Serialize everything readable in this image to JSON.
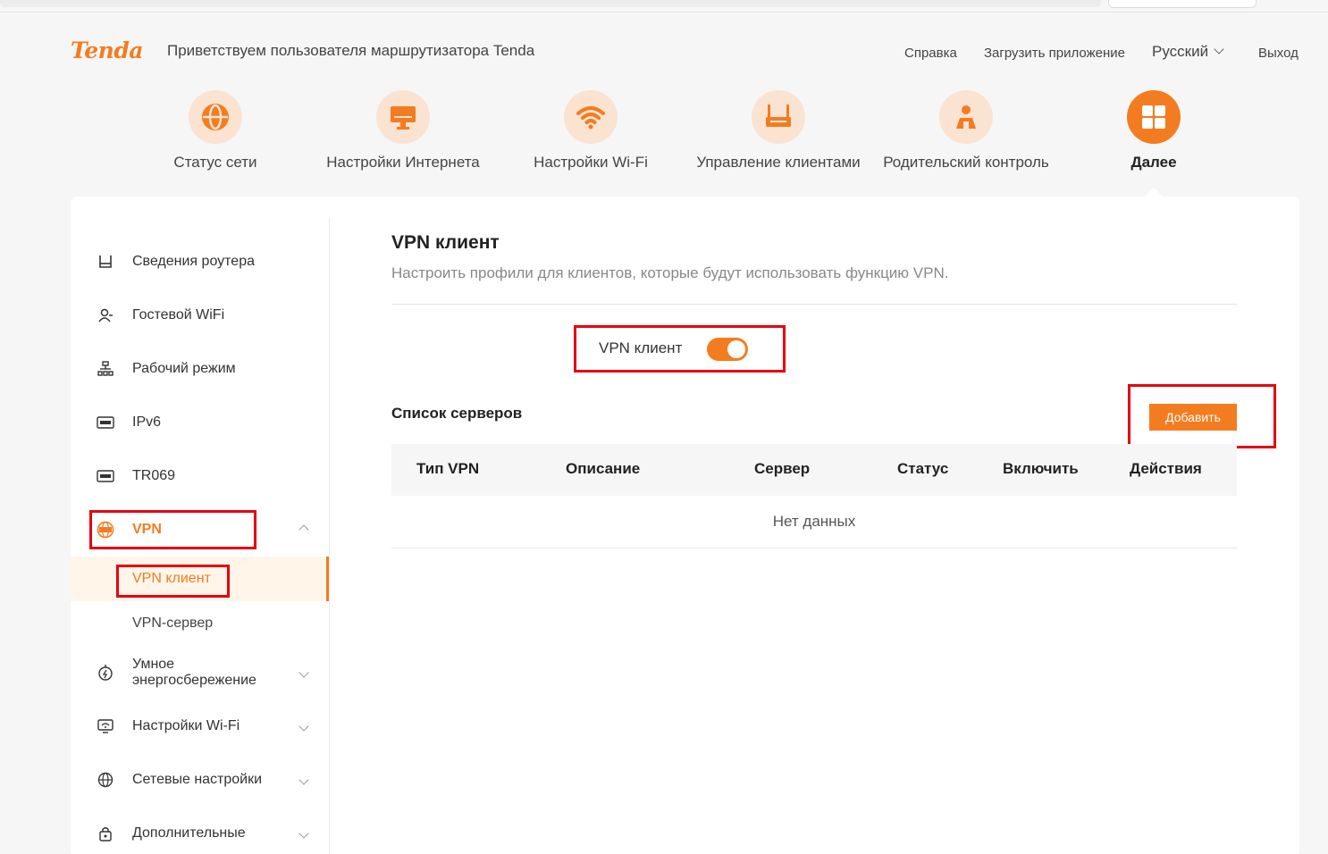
{
  "header": {
    "logo_text": "Tenda",
    "welcome": "Приветствуем пользователя маршрутизатора Tenda",
    "links": {
      "help": "Справка",
      "download_app": "Загрузить приложение",
      "language": "Русский",
      "logout": "Выход"
    }
  },
  "topnav": [
    {
      "label": "Статус сети",
      "icon": "globe-icon"
    },
    {
      "label": "Настройки Интернета",
      "icon": "monitor-icon"
    },
    {
      "label": "Настройки Wi-Fi",
      "icon": "wifi-icon"
    },
    {
      "label": "Управление клиентами",
      "icon": "router-icon"
    },
    {
      "label": "Родительский контроль",
      "icon": "parental-icon"
    },
    {
      "label": "Далее",
      "icon": "grid-icon",
      "active": true
    }
  ],
  "sidebar": {
    "items": [
      {
        "label": "Сведения роутера",
        "icon": "router-info-icon"
      },
      {
        "label": "Гостевой WiFi",
        "icon": "guest-user-icon"
      },
      {
        "label": "Рабочий режим",
        "icon": "topology-icon"
      },
      {
        "label": "IPv6",
        "icon": "ipv6-icon"
      },
      {
        "label": "TR069",
        "icon": "tr069-icon"
      },
      {
        "label": "VPN",
        "icon": "vpn-icon",
        "expanded": true
      },
      {
        "label": "VPN клиент",
        "sub": true,
        "active": true
      },
      {
        "label": "VPN-сервер",
        "sub": true
      },
      {
        "label": "Умное энергосбережение",
        "icon": "energy-saving-icon"
      },
      {
        "label": "Настройки Wi-Fi",
        "icon": "wifi-settings-icon"
      },
      {
        "label": "Сетевые настройки",
        "icon": "network-globe-icon"
      },
      {
        "label": "Дополнительные",
        "icon": "lock-icon"
      }
    ]
  },
  "main": {
    "title": "VPN клиент",
    "description": "Настроить профили для клиентов, которые будут использовать функцию VPN.",
    "toggle_label": "VPN клиент",
    "toggle_on": true,
    "servers_title": "Список серверов",
    "add_button": "Добавить",
    "table": {
      "columns": [
        "Тип VPN",
        "Описание",
        "Сервер",
        "Статус",
        "Включить",
        "Действия"
      ],
      "empty_text": "Нет данных"
    }
  },
  "colors": {
    "accent": "#f47c20",
    "highlight": "#e60012",
    "icon_bg": "#fbe3d1"
  }
}
